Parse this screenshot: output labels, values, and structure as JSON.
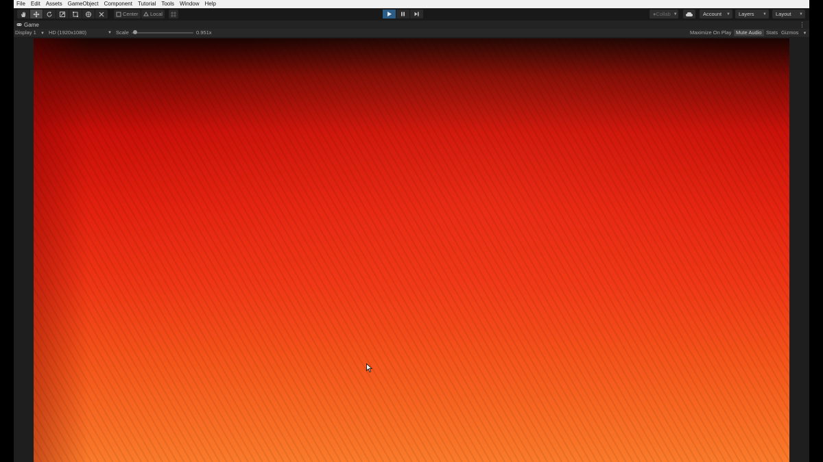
{
  "menu": [
    "File",
    "Edit",
    "Assets",
    "GameObject",
    "Component",
    "Tutorial",
    "Tools",
    "Window",
    "Help"
  ],
  "toolbar": {
    "tools": [
      "hand-icon",
      "move-icon",
      "rotate-icon",
      "scale-icon",
      "rect-icon",
      "transform-icon",
      "custom-tool-icon"
    ],
    "pivot_label": "Center",
    "space_label": "Local",
    "collab_label": "Collab",
    "account_label": "Account",
    "layers_label": "Layers",
    "layout_label": "Layout"
  },
  "game": {
    "tab_label": "Game",
    "display_label": "Display 1",
    "resolution_label": "HD (1920x1080)",
    "scale_label": "Scale",
    "scale_value": "0.951x",
    "scale_fraction": 0.06,
    "maximize_label": "Maximize On Play",
    "mute_label": "Mute Audio",
    "stats_label": "Stats",
    "gizmos_label": "Gizmos"
  },
  "colors": {
    "play_active": "#2c5d87",
    "render_top": "#1a0402",
    "render_bottom": "#fa7a2a"
  }
}
